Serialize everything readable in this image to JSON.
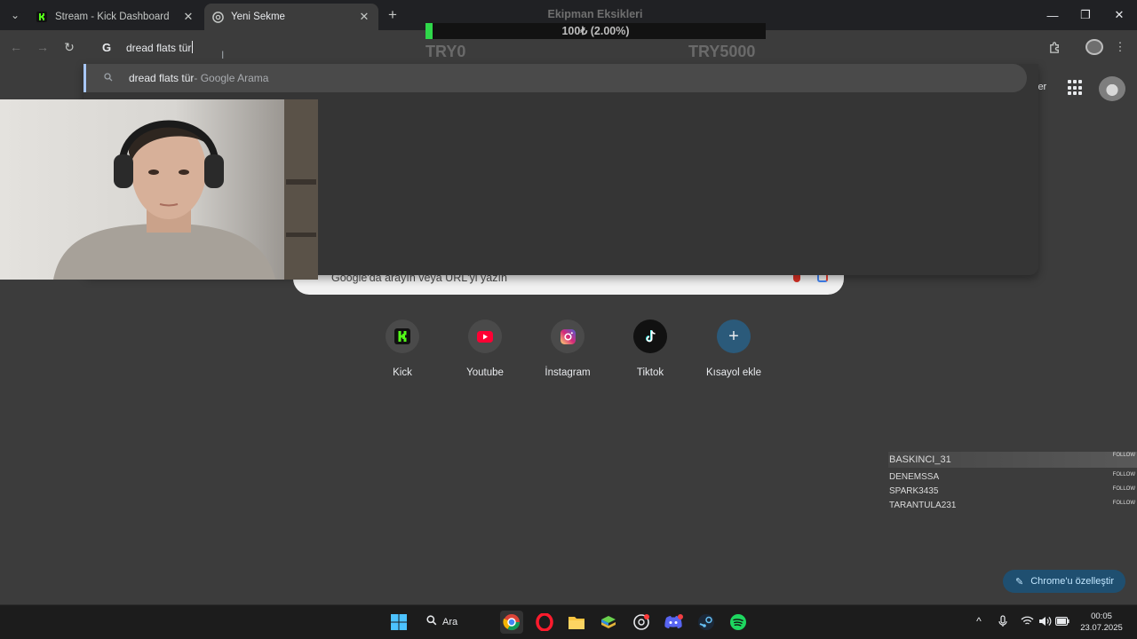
{
  "tabs": [
    {
      "title": "Stream - Kick Dashboard",
      "favicon": "kick-icon",
      "active": false
    },
    {
      "title": "Yeni Sekme",
      "favicon": "chrome-icon",
      "active": true
    }
  ],
  "goal_overlay": {
    "title": "Ekipman Eksikleri",
    "progress_text": "100₺ (2.00%)",
    "progress_fraction": 0.02,
    "min_label": "TRY0",
    "max_label": "TRY5000",
    "fill_color": "#2fd84a"
  },
  "omnibox": {
    "value": "dread flats tür",
    "suggestions": [
      {
        "text": "dread flats tür",
        "suffix": " - Google Arama",
        "icon": "search-icon"
      }
    ]
  },
  "ntp": {
    "partial_header_text": "ler",
    "search_placeholder": "Google'da arayın veya URL'yi yazın",
    "shortcuts": [
      {
        "label": "Kick",
        "icon": "kick-icon"
      },
      {
        "label": "Youtube",
        "icon": "youtube-icon"
      },
      {
        "label": "İnstagram",
        "icon": "instagram-icon"
      },
      {
        "label": "Tiktok",
        "icon": "tiktok-icon"
      },
      {
        "label": "Kısayol ekle",
        "icon": "plus-icon"
      }
    ],
    "customize_label": "Chrome'u özelleştir"
  },
  "followers": {
    "tag": "FOLLOW",
    "items": [
      "BASKINCI_31",
      "DENEMSSA",
      "SPARK3435",
      "TARANTULA231"
    ]
  },
  "taskbar": {
    "search_label": "Ara",
    "apps": [
      "windows-start-icon",
      "chrome-icon",
      "opera-icon",
      "file-explorer-icon",
      "bluestacks-icon",
      "github-desktop-icon",
      "discord-icon",
      "steam-icon",
      "spotify-icon"
    ],
    "time": "00:05",
    "date": "23.07.2025"
  },
  "colors": {
    "accent": "#a8c7fa",
    "kick_green": "#53fc18",
    "youtube_red": "#ff0033",
    "spotify_green": "#1ed760"
  }
}
